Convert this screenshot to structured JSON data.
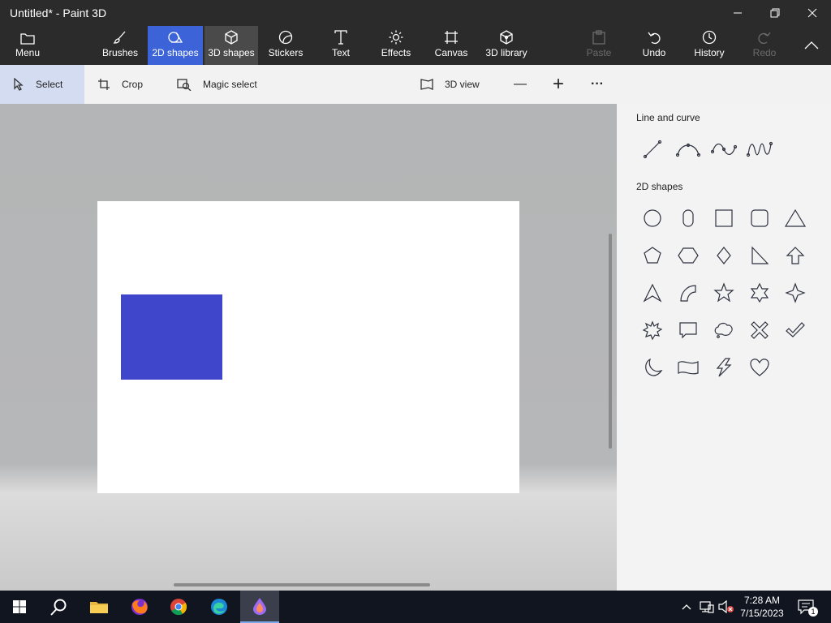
{
  "window": {
    "title": "Untitled* - Paint 3D"
  },
  "ribbon": {
    "menu": "Menu",
    "brushes": "Brushes",
    "shapes2d": "2D shapes",
    "shapes3d": "3D shapes",
    "stickers": "Stickers",
    "text": "Text",
    "effects": "Effects",
    "canvas": "Canvas",
    "library3d": "3D library",
    "paste": "Paste",
    "undo": "Undo",
    "history": "History",
    "redo": "Redo"
  },
  "toolbar": {
    "select": "Select",
    "crop": "Crop",
    "magic_select": "Magic select",
    "view3d": "3D view",
    "zoom_out": "—",
    "zoom_in": "+",
    "more": "···"
  },
  "panel": {
    "line_section": "Line and curve",
    "shapes_section": "2D shapes"
  },
  "canvas": {
    "shape_color": "#4046cc"
  },
  "taskbar": {
    "time": "7:28 AM",
    "date": "7/15/2023",
    "notification_count": "1"
  }
}
